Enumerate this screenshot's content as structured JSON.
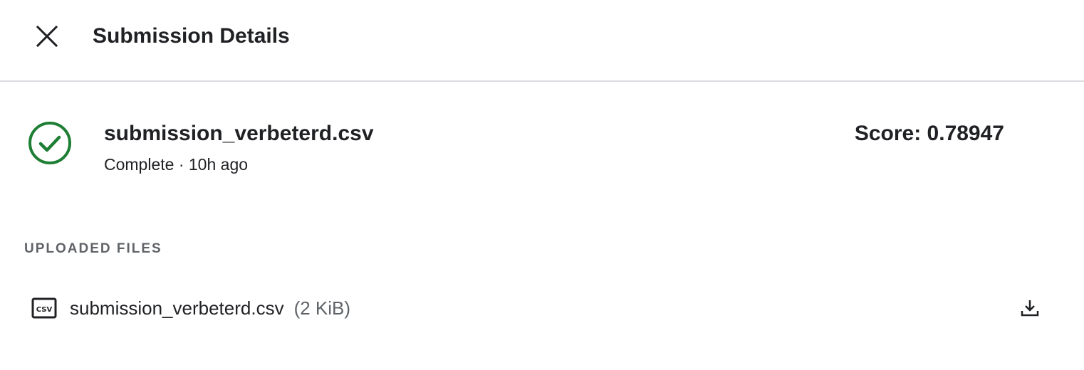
{
  "header": {
    "title": "Submission Details",
    "close_icon": "close-icon"
  },
  "submission": {
    "file_name": "submission_verbeterd.csv",
    "status": "Complete",
    "separator": " · ",
    "time_ago": "10h ago",
    "score_label": "Score: 0.78947",
    "status_icon": "check-circle-icon",
    "status_color": "#1e7e34"
  },
  "uploaded_files": {
    "section_label": "UPLOADED FILES",
    "files": [
      {
        "name": "submission_verbeterd.csv",
        "size": "(2 KiB)",
        "icon": "csv-file-icon",
        "action_icon": "download-icon"
      }
    ]
  }
}
